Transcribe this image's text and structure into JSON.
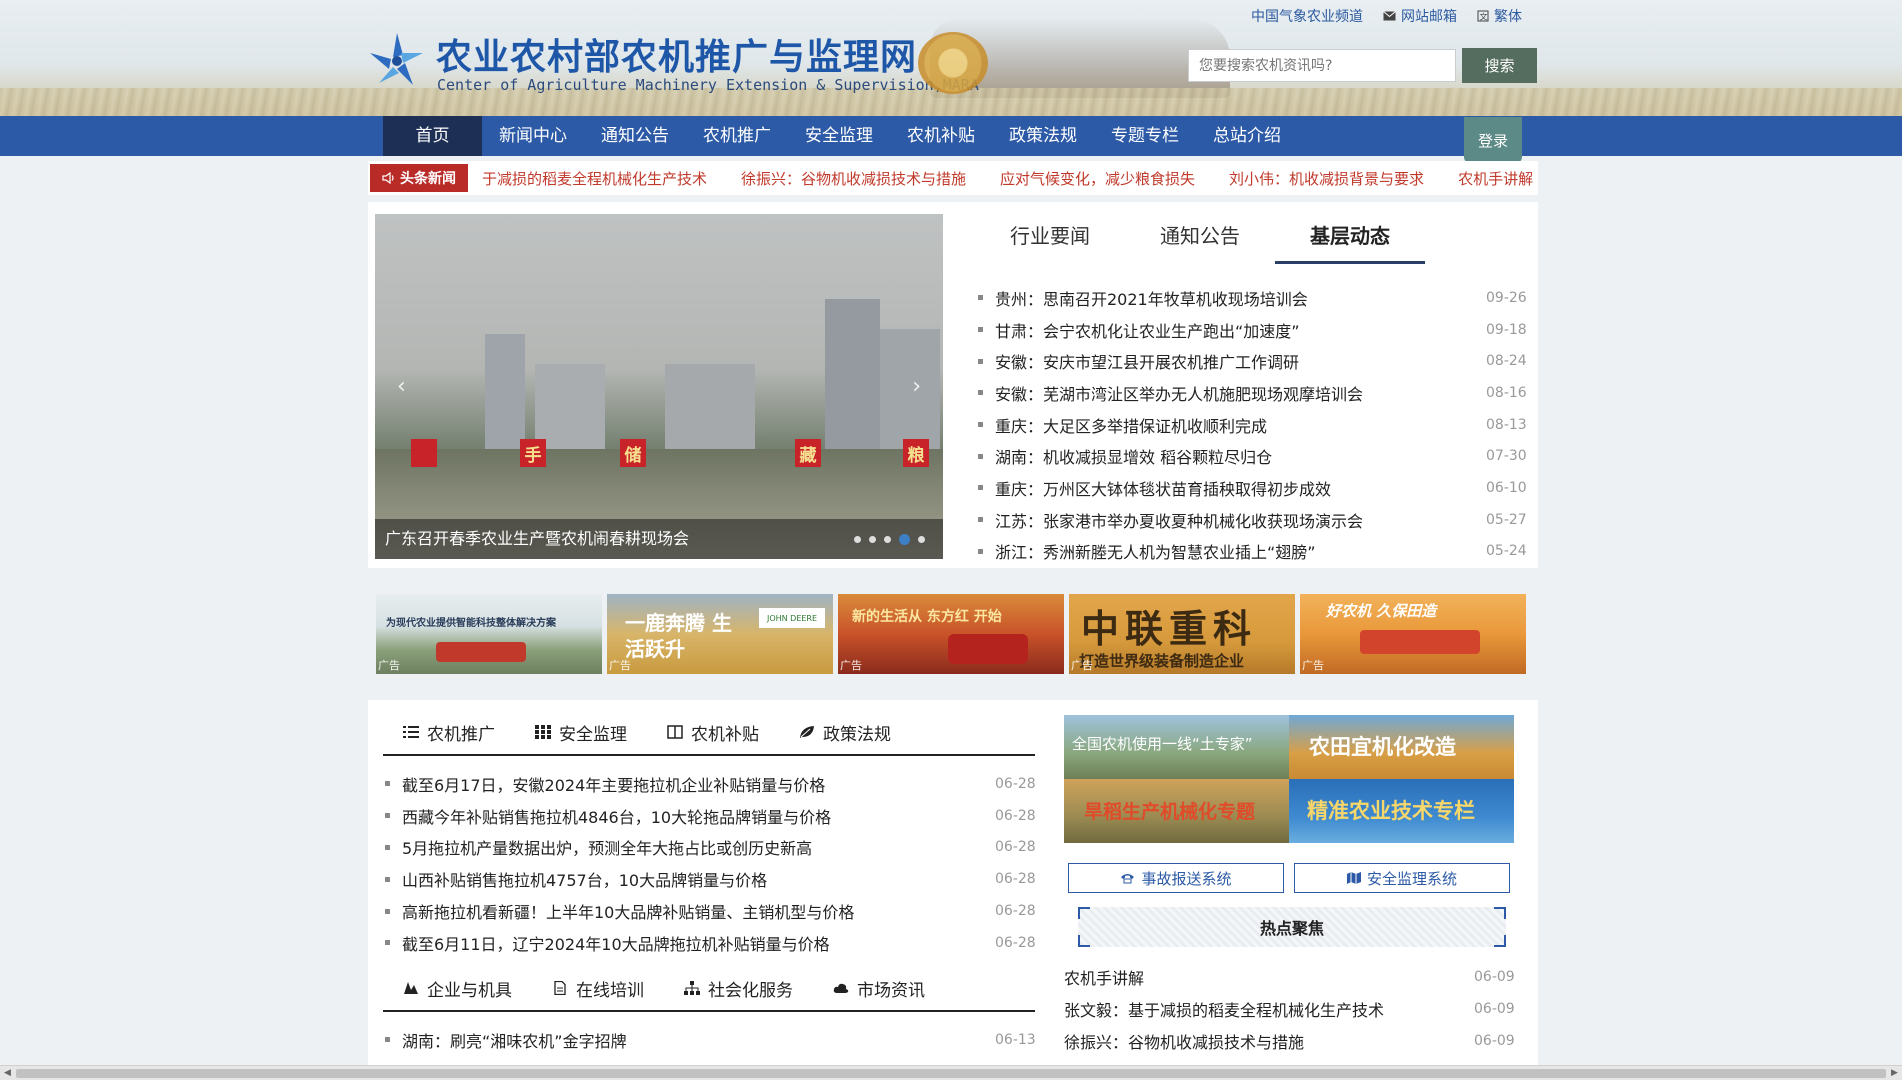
{
  "header": {
    "title": "农业农村部农机推广与监理网",
    "subtitle": "Center of Agriculture Machinery Extension & Supervision,MARA",
    "top_links": [
      "中国气象农业频道",
      "网站邮箱",
      "繁体"
    ],
    "search_placeholder": "您要搜索农机资讯吗?",
    "search_button": "搜索"
  },
  "nav": {
    "items": [
      "首页",
      "新闻中心",
      "通知公告",
      "农机推广",
      "安全监理",
      "农机补贴",
      "政策法规",
      "专题专栏",
      "总站介绍"
    ],
    "login": "登录"
  },
  "ticker": {
    "label": "头条新闻",
    "items": [
      "于减损的稻麦全程机械化生产技术",
      "徐振兴：谷物机收减损技术与措施",
      "应对气候变化，减少粮食损失",
      "刘小伟：机收减损背景与要求",
      "农机手讲解"
    ]
  },
  "slider": {
    "caption": "广东召开春季农业生产暨农机闹春耕现场会",
    "banner_chars": [
      "手",
      "储",
      "藏",
      "粮"
    ],
    "active_dot": 4,
    "dot_count": 5
  },
  "tabs1": [
    "行业要闻",
    "通知公告",
    "基层动态"
  ],
  "news1": [
    {
      "title": "贵州：思南召开2021年牧草机收现场培训会",
      "date": "09-26"
    },
    {
      "title": "甘肃：会宁农机化让农业生产跑出“加速度”",
      "date": "09-18"
    },
    {
      "title": "安徽：安庆市望江县开展农机推广工作调研",
      "date": "08-24"
    },
    {
      "title": "安徽：芜湖市湾沚区举办无人机施肥现场观摩培训会",
      "date": "08-16"
    },
    {
      "title": "重庆：大足区多举措保证机收顺利完成",
      "date": "08-13"
    },
    {
      "title": "湖南：机收减损显增效 稻谷颗粒尽归仓",
      "date": "07-30"
    },
    {
      "title": "重庆：万州区大钵体毯状苗育插秧取得初步成效",
      "date": "06-10"
    },
    {
      "title": "江苏：张家港市举办夏收夏种机械化收获现场演示会",
      "date": "05-27"
    },
    {
      "title": "浙江：秀洲新塍无人机为智慧农业插上“翅膀”",
      "date": "05-24"
    }
  ],
  "ads": [
    {
      "label": "广告",
      "text": "为现代农业提供智能科技整体解决方案"
    },
    {
      "label": "广告",
      "text": "一鹿奔腾 生活跃升",
      "brand": "JOHN DEERE"
    },
    {
      "label": "广告",
      "text": "新的生活从 东方红 开始"
    },
    {
      "label": "广告",
      "text": "中联重科",
      "sub": "打造世界级装备制造企业"
    },
    {
      "label": "广告",
      "text": "好农机 久保田造"
    }
  ],
  "tabs2": [
    "农机推广",
    "安全监理",
    "农机补贴",
    "政策法规"
  ],
  "news2": [
    {
      "title": "截至6月17日，安徽2024年主要拖拉机企业补贴销量与价格",
      "date": "06-28"
    },
    {
      "title": "西藏今年补贴销售拖拉机4846台，10大轮拖品牌销量与价格",
      "date": "06-28"
    },
    {
      "title": "5月拖拉机产量数据出炉，预测全年大拖占比或创历史新高",
      "date": "06-28"
    },
    {
      "title": "山西补贴销售拖拉机4757台，10大品牌销量与价格",
      "date": "06-28"
    },
    {
      "title": "高新拖拉机看新疆！上半年10大品牌补贴销量、主销机型与价格",
      "date": "06-28"
    },
    {
      "title": "截至6月11日，辽宁2024年10大品牌拖拉机补贴销量与价格",
      "date": "06-28"
    }
  ],
  "tabs3": [
    "企业与机具",
    "在线培训",
    "社会化服务",
    "市场资讯"
  ],
  "news3": [
    {
      "title": "湖南：刷亮“湘味农机”金字招牌",
      "date": "06-13"
    }
  ],
  "topic_banners": [
    "全国农机使用一线“土专家”",
    "农田宜机化改造",
    "旱稻生产机械化专题",
    "精准农业技术专栏"
  ],
  "systems": [
    "事故报送系统",
    "安全监理系统"
  ],
  "hot": {
    "title": "热点聚焦",
    "items": [
      {
        "title": "农机手讲解",
        "date": "06-09"
      },
      {
        "title": "张文毅：基于减损的稻麦全程机械化生产技术",
        "date": "06-09"
      },
      {
        "title": "徐振兴：谷物机收减损技术与措施",
        "date": "06-09"
      }
    ]
  },
  "colors": {
    "nav": "#2c5aa6",
    "nav_active": "#1d2f55",
    "ticker_tag": "#b92b27",
    "ticker_text": "#c0392b",
    "logo": "#1f57a8",
    "search_btn": "#556d5f"
  }
}
